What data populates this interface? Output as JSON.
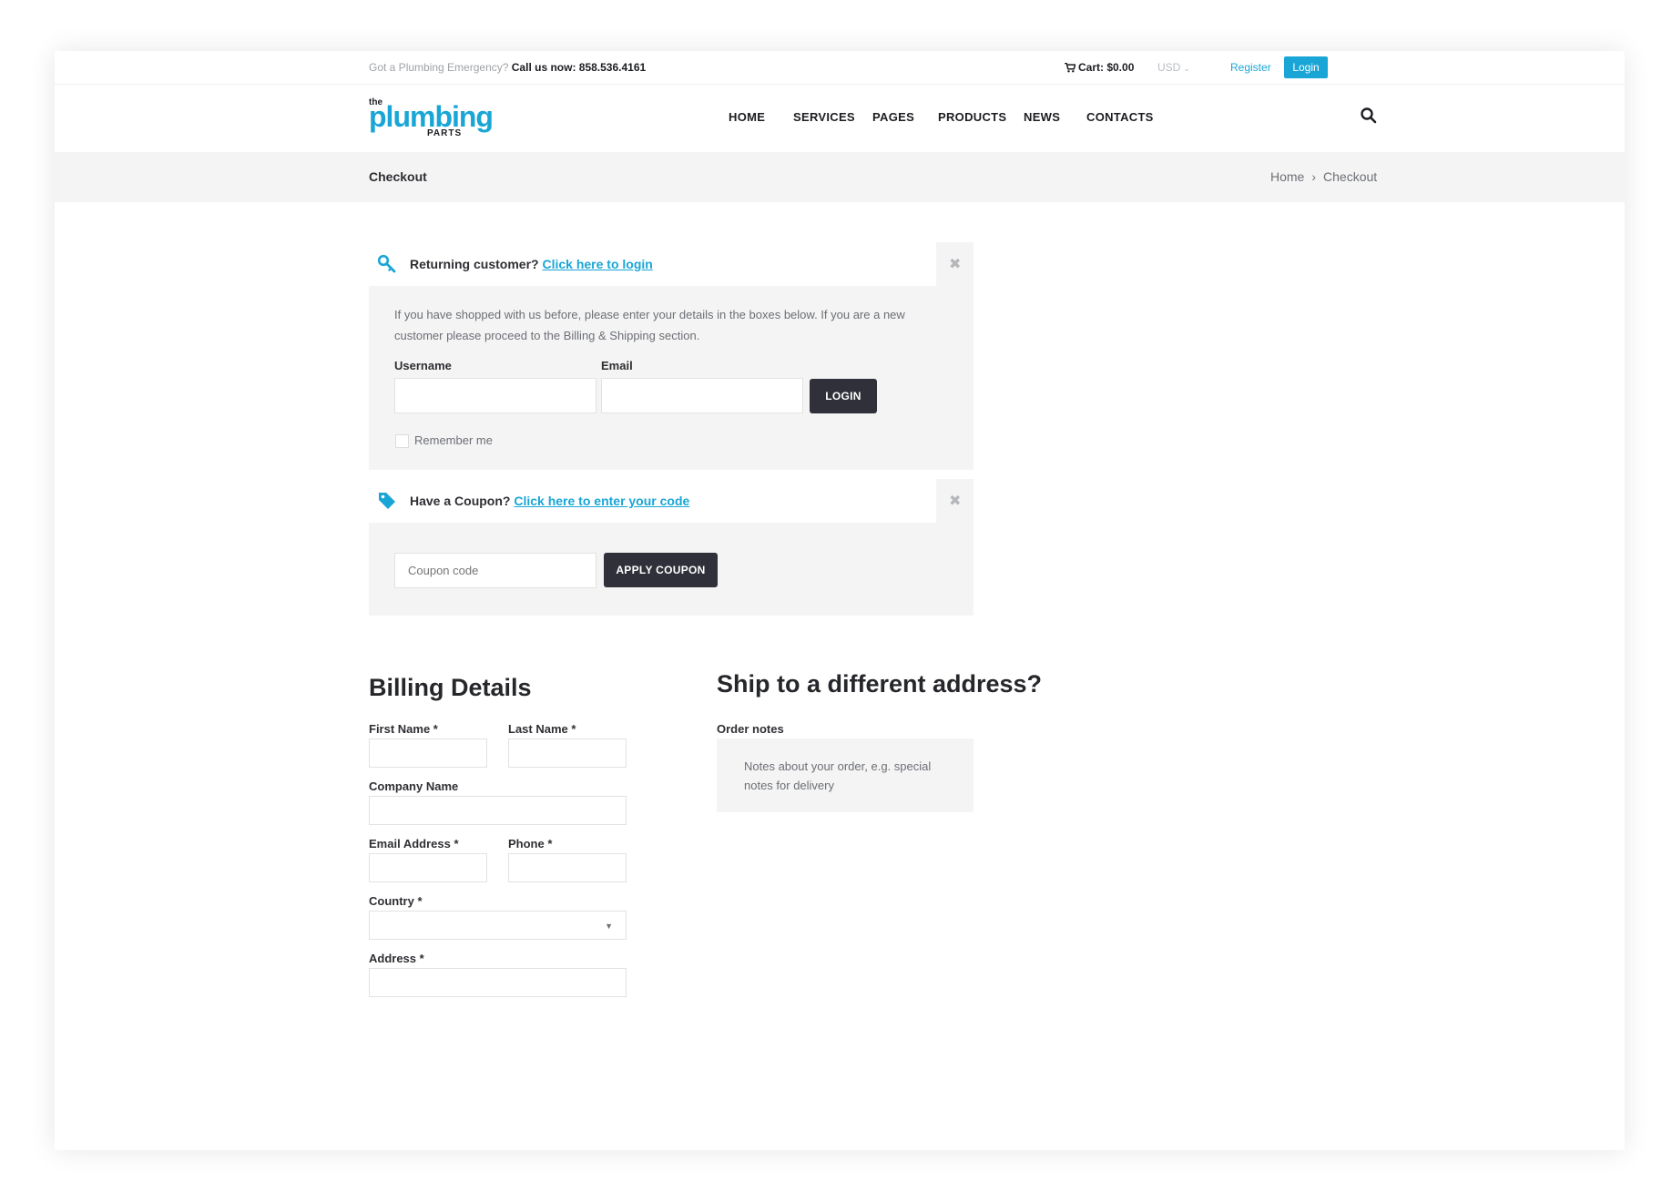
{
  "topbar": {
    "emergency_text": "Got a Plumbing Emergency?",
    "call_text": "Call us now: 858.536.4161",
    "cart_label": "Cart: $0.00",
    "currency": "USD",
    "register_label": "Register",
    "login_label": "Login"
  },
  "logo": {
    "the": "the",
    "plumbing": "plumbing",
    "parts": "PARTS"
  },
  "nav": {
    "items": [
      "HOME",
      "SERVICES",
      "PAGES",
      "PRODUCTS",
      "NEWS",
      "CONTACTS"
    ]
  },
  "page": {
    "title": "Checkout",
    "breadcrumb": {
      "home": "Home",
      "current": "Checkout"
    }
  },
  "login_notice": {
    "prompt": "Returning customer?",
    "link": "Click here to login",
    "description": "If you have shopped with us before, please enter your details in the boxes below. If you are a new customer please proceed to the Billing & Shipping section.",
    "username_label": "Username",
    "email_label": "Email",
    "login_button": "LOGIN",
    "remember_label": "Remember me"
  },
  "coupon_notice": {
    "prompt": "Have a Coupon?",
    "link": "Click here to enter your code",
    "placeholder": "Coupon code",
    "apply_button": "APPLY COUPON"
  },
  "billing": {
    "heading": "Billing Details",
    "first_name": "First Name *",
    "last_name": "Last Name *",
    "company": "Company Name",
    "email": "Email Address *",
    "phone": "Phone *",
    "country": "Country *",
    "address": "Address *"
  },
  "shipping": {
    "heading": "Ship to a different address?",
    "order_notes_label": "Order notes",
    "order_notes_placeholder": "Notes about your order, e.g. special notes for delivery"
  },
  "colors": {
    "accent": "#19a6d6",
    "dark_button": "#2f3039",
    "panel": "#f4f4f4"
  }
}
